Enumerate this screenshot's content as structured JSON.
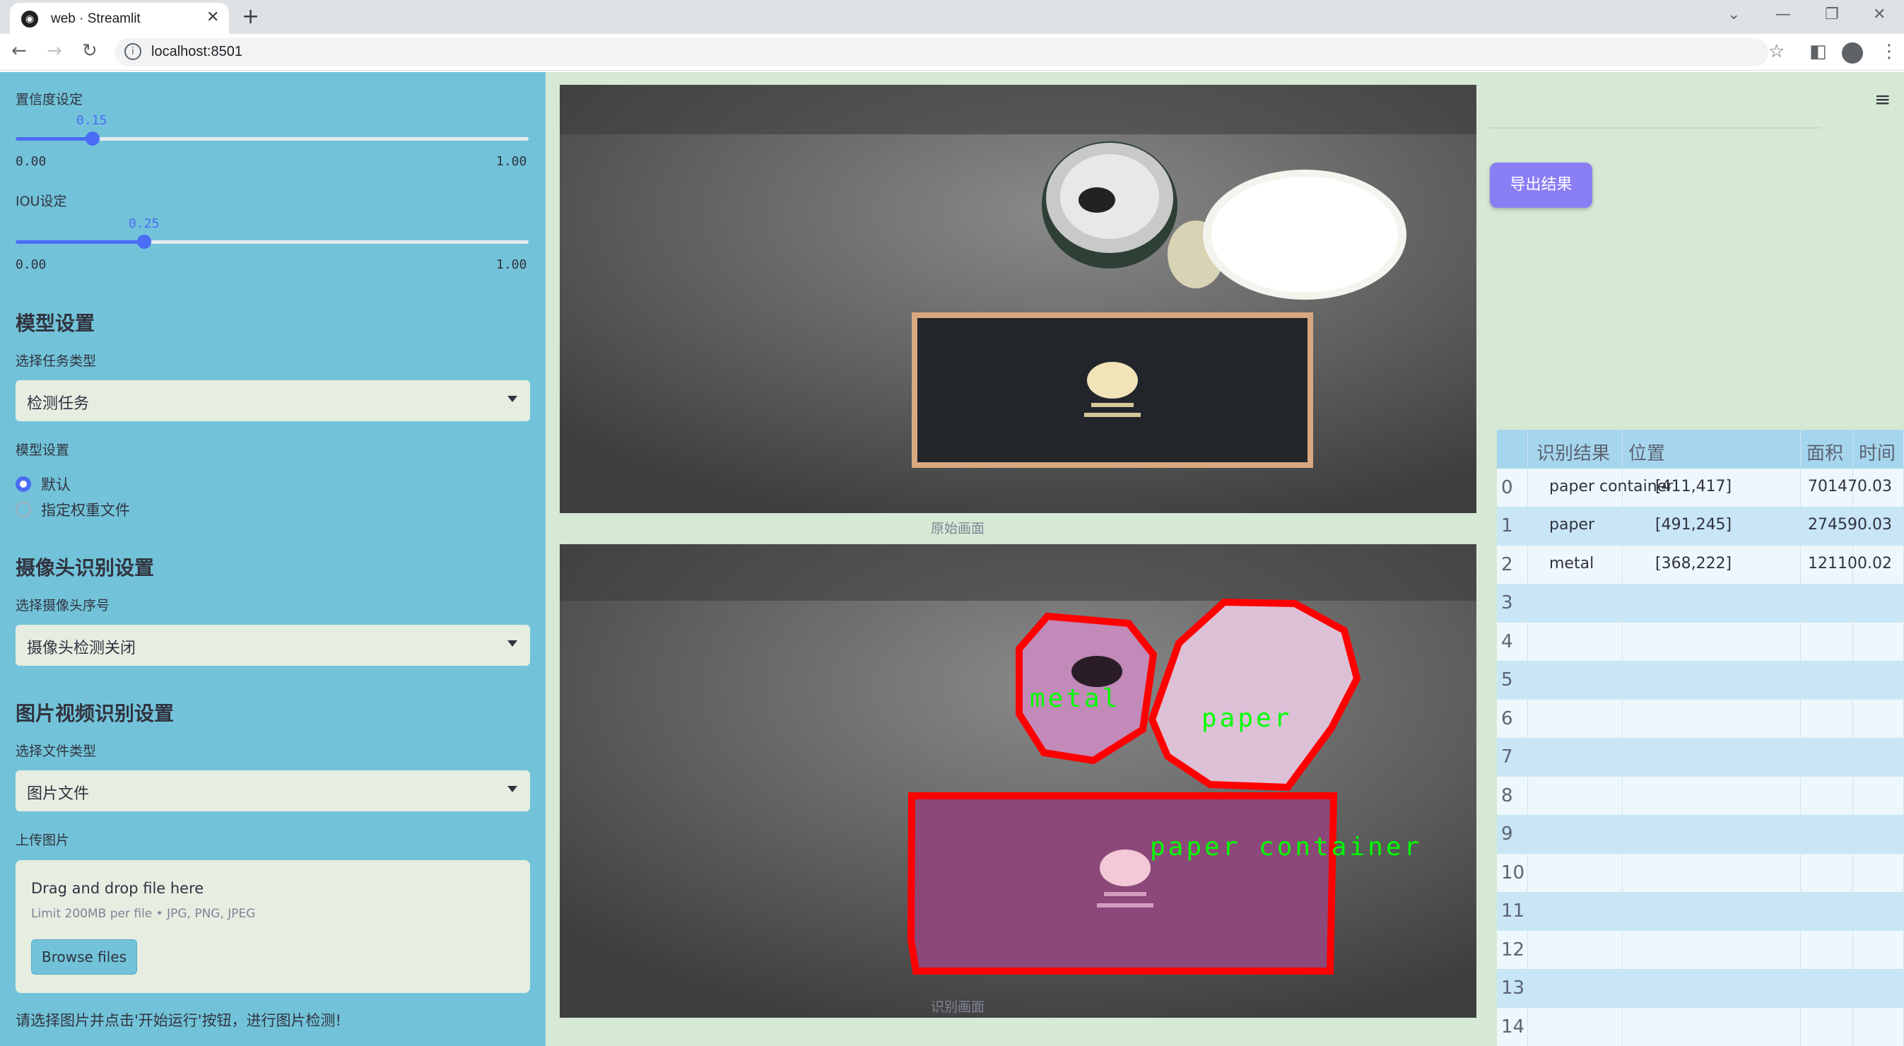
{
  "browser": {
    "tab_title": "web · Streamlit",
    "url": "localhost:8501"
  },
  "sidebar": {
    "confidence": {
      "label": "置信度设定",
      "value": "0.15",
      "level": 0.15,
      "min": "0.00",
      "max": "1.00"
    },
    "iou": {
      "label": "IOU设定",
      "value": "0.25",
      "level": 0.25,
      "min": "0.00",
      "max": "1.00"
    },
    "model_section": {
      "title": "模型设置",
      "task_label": "选择任务类型",
      "task_value": "检测任务",
      "model_label": "模型设置",
      "options": [
        "默认",
        "指定权重文件"
      ],
      "selected": "默认"
    },
    "camera_section": {
      "title": "摄像头识别设置",
      "label": "选择摄像头序号",
      "value": "摄像头检测关闭"
    },
    "file_section": {
      "title": "图片视频识别设置",
      "type_label": "选择文件类型",
      "type_value": "图片文件",
      "upload_label": "上传图片",
      "drag_text": "Drag and drop file here",
      "limit_text": "Limit 200MB per file • JPG, PNG, JPEG",
      "browse_label": "Browse files"
    },
    "hint": "请选择图片并点击'开始运行'按钮，进行图片检测!"
  },
  "main": {
    "original_caption": "原始画面",
    "detected_caption": "识别画面",
    "export_label": "导出结果",
    "detections": [
      "metal",
      "paper",
      "paper container"
    ],
    "colors": {
      "box": "#ff0000",
      "label": "#00ff00",
      "sidebar": "#72c3d9",
      "accent": "#4b6cf5"
    }
  },
  "table": {
    "headers": [
      "识别结果",
      "位置",
      "面积",
      "时间"
    ],
    "rows": [
      {
        "idx": "0",
        "result": "paper container",
        "pos": "[411,417]",
        "area": "70147",
        "time": "0.03"
      },
      {
        "idx": "1",
        "result": "paper",
        "pos": "[491,245]",
        "area": "27459",
        "time": "0.03"
      },
      {
        "idx": "2",
        "result": "metal",
        "pos": "[368,222]",
        "area": "12110",
        "time": "0.02"
      },
      {
        "idx": "3",
        "result": "",
        "pos": "",
        "area": "",
        "time": ""
      },
      {
        "idx": "4",
        "result": "",
        "pos": "",
        "area": "",
        "time": ""
      },
      {
        "idx": "5",
        "result": "",
        "pos": "",
        "area": "",
        "time": ""
      },
      {
        "idx": "6",
        "result": "",
        "pos": "",
        "area": "",
        "time": ""
      },
      {
        "idx": "7",
        "result": "",
        "pos": "",
        "area": "",
        "time": ""
      },
      {
        "idx": "8",
        "result": "",
        "pos": "",
        "area": "",
        "time": ""
      },
      {
        "idx": "9",
        "result": "",
        "pos": "",
        "area": "",
        "time": ""
      },
      {
        "idx": "10",
        "result": "",
        "pos": "",
        "area": "",
        "time": ""
      },
      {
        "idx": "11",
        "result": "",
        "pos": "",
        "area": "",
        "time": ""
      },
      {
        "idx": "12",
        "result": "",
        "pos": "",
        "area": "",
        "time": ""
      },
      {
        "idx": "13",
        "result": "",
        "pos": "",
        "area": "",
        "time": ""
      },
      {
        "idx": "14",
        "result": "",
        "pos": "",
        "area": "",
        "time": ""
      }
    ]
  }
}
